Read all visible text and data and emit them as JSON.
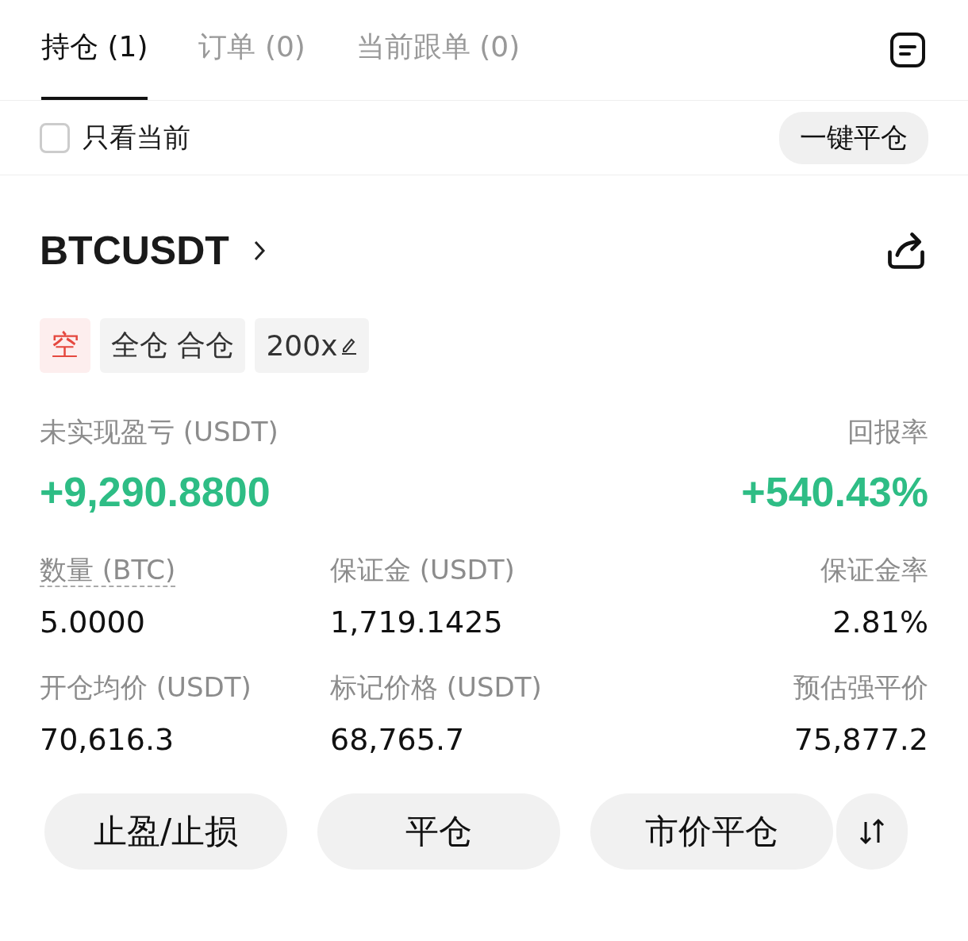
{
  "tabs": [
    {
      "label": "持仓 (1)",
      "selected": true
    },
    {
      "label": "订单 (0)",
      "selected": false
    },
    {
      "label": "当前跟单 (0)",
      "selected": false
    }
  ],
  "filter": {
    "label": "只看当前",
    "checked": false
  },
  "close_all_button": "一键平仓",
  "position": {
    "symbol": "BTCUSDT",
    "side": "空",
    "margin_mode": "全仓 合仓",
    "leverage": "200x",
    "pnl_label": "未实现盈亏 (USDT)",
    "pnl_value": "+9,290.8800",
    "roe_label": "回报率",
    "roe_value": "+540.43%",
    "stats": [
      {
        "label": "数量 (BTC)",
        "value": "5.0000",
        "underlined": true
      },
      {
        "label": "保证金 (USDT)",
        "value": "1,719.1425",
        "underlined": false
      },
      {
        "label": "保证金率",
        "value": "2.81%",
        "underlined": false
      },
      {
        "label": "开仓均价 (USDT)",
        "value": "70,616.3",
        "underlined": false
      },
      {
        "label": "标记价格 (USDT)",
        "value": "68,765.7",
        "underlined": false
      },
      {
        "label": "预估强平价",
        "value": "75,877.2",
        "underlined": false
      }
    ]
  },
  "buttons": [
    "止盈/止损",
    "平仓",
    "市价平仓"
  ]
}
